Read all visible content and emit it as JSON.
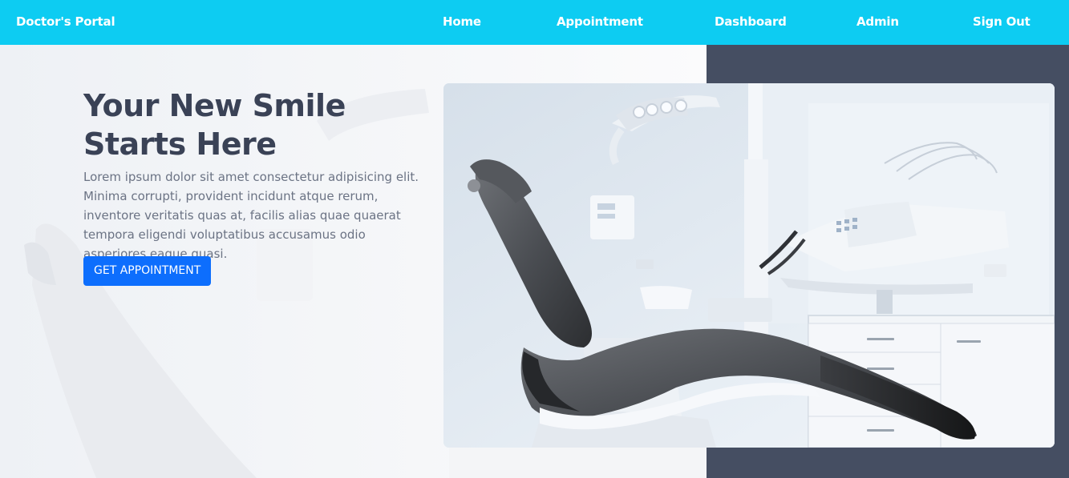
{
  "navbar": {
    "brand": "Doctor's Portal",
    "links": [
      "Home",
      "Appointment",
      "Dashboard",
      "Admin",
      "Sign Out"
    ],
    "background": "#0dccf2"
  },
  "hero": {
    "title": "Your New Smile Starts Here",
    "description": "Lorem ipsum dolor sit amet consectetur adipisicing elit. Minima corrupti, provident incidunt atque rerum, inventore veritatis quas at, facilis alias quae quaerat tempora eligendi voluptatibus accusamus odio asperiores eaque quasi.",
    "button_label": "GET APPOINTMENT",
    "button_color": "#0d6efd",
    "right_panel_color": "#454e62"
  }
}
